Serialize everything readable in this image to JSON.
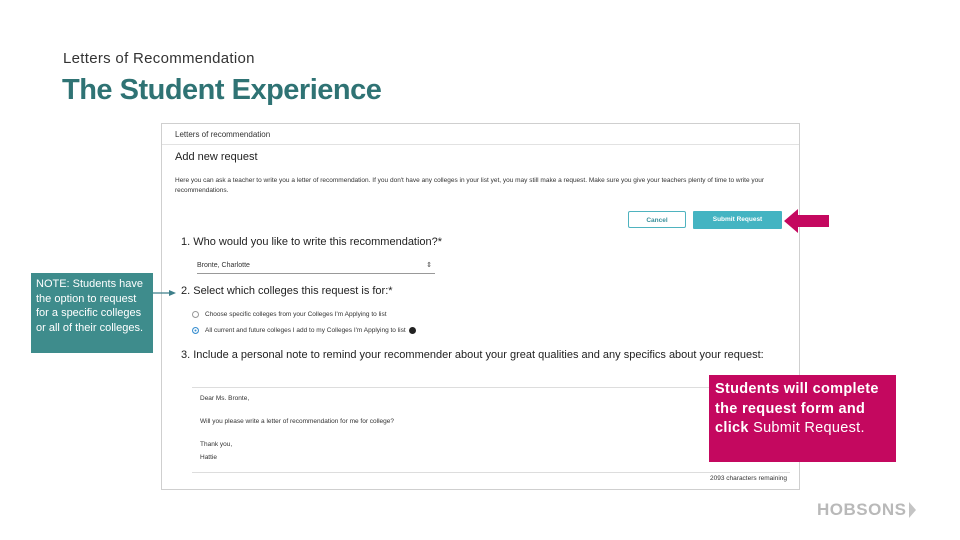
{
  "slide": {
    "kicker": "Letters of Recommendation",
    "title": "The Student Experience"
  },
  "screenshot": {
    "breadcrumb": "Letters of recommendation",
    "heading": "Add new request",
    "intro": "Here you can ask a teacher to write you a letter of recommendation. If you don't have any colleges in your list yet, you may still make a request. Make sure you give your teachers plenty of time to write your recommendations.",
    "cancel_label": "Cancel",
    "submit_label": "Submit Request",
    "q1": "1. Who would you like to write this recommendation?*",
    "recommender_value": "Bronte, Charlotte",
    "q2": "2. Select which colleges this request is for:*",
    "option_specific": "Choose specific colleges from your Colleges I'm Applying to list",
    "option_all": "All current and future colleges I add to my Colleges I'm Applying to list",
    "q3": "3. Include a personal note to remind your recommender about your great qualities and any specifics about your request:",
    "note_lines": [
      "Dear Ms. Bronte,",
      "Will you please write a letter of recommendation for me for college?",
      "Thank you,",
      "Hattie"
    ],
    "chars_remaining": "2093 characters remaining"
  },
  "callouts": {
    "note": "NOTE: Students have the option to request for a specific colleges or all of their colleges.",
    "students_bold": "Students will complete the request form and click",
    "students_tail": "Submit Request."
  },
  "logo": "HOBSONS",
  "colors": {
    "title": "#2f7374",
    "note_callout": "#3e8c8c",
    "students_callout": "#c4085f",
    "arrow": "#c4085f",
    "submit_button": "#44b4c2"
  },
  "icons": {
    "dropdown": "chevron-updown-icon",
    "info": "info-icon",
    "pointer": "arrow-left-icon",
    "logo_mark": "chevron-right-icon"
  }
}
